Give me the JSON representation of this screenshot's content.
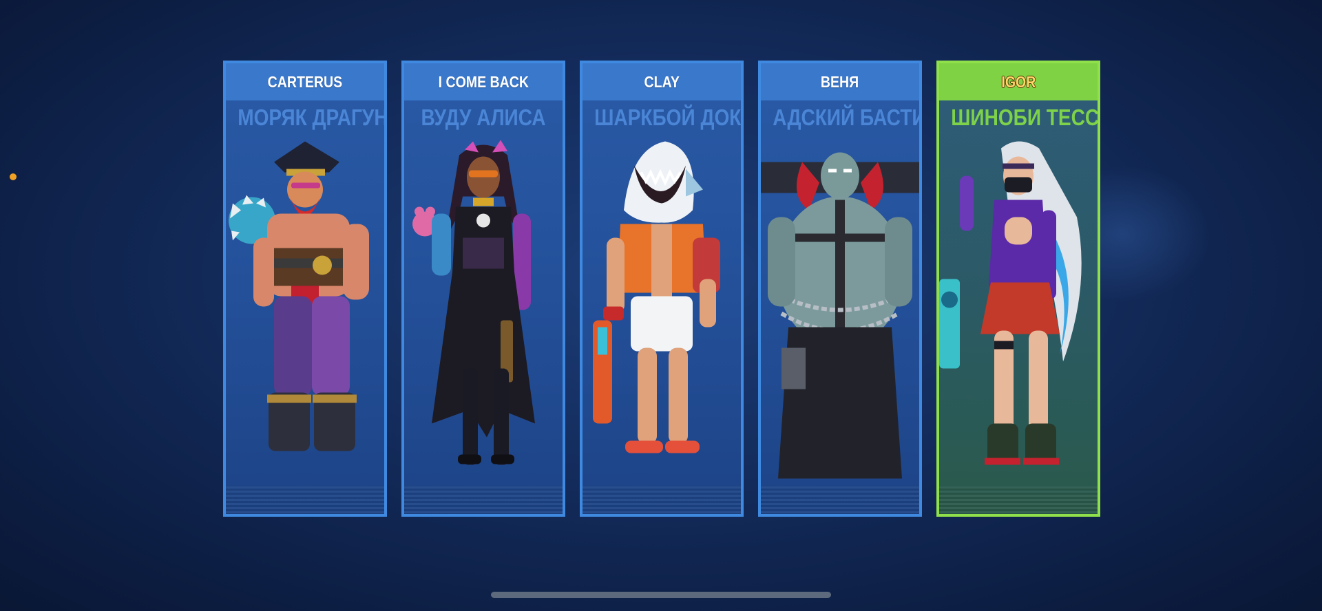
{
  "colors": {
    "card_border": "#3f8ae0",
    "card_header": "#3a78cc",
    "selected_border": "#8fe04a",
    "selected_header": "#7fd243",
    "selected_player_name": "#ffd86a",
    "status_dot": "#f2a124"
  },
  "cards": [
    {
      "player": "CARTERUS",
      "hero": "МОРЯК ДРАГУН",
      "selected": false,
      "icon": "pirate-hero-icon"
    },
    {
      "player": "I COME BACK",
      "hero": "ВУДУ АЛИСА",
      "selected": false,
      "icon": "voodoo-hero-icon"
    },
    {
      "player": "CLAY",
      "hero": "ШАРКБОЙ ДОК",
      "selected": false,
      "icon": "shark-hero-icon"
    },
    {
      "player": "ВЕНЯ",
      "hero": "АДСКИЙ БАСТИОН",
      "selected": false,
      "icon": "brute-hero-icon"
    },
    {
      "player": "IGOR",
      "hero": "ШИНОБИ ТЕСС",
      "selected": true,
      "icon": "ninja-hero-icon"
    }
  ]
}
